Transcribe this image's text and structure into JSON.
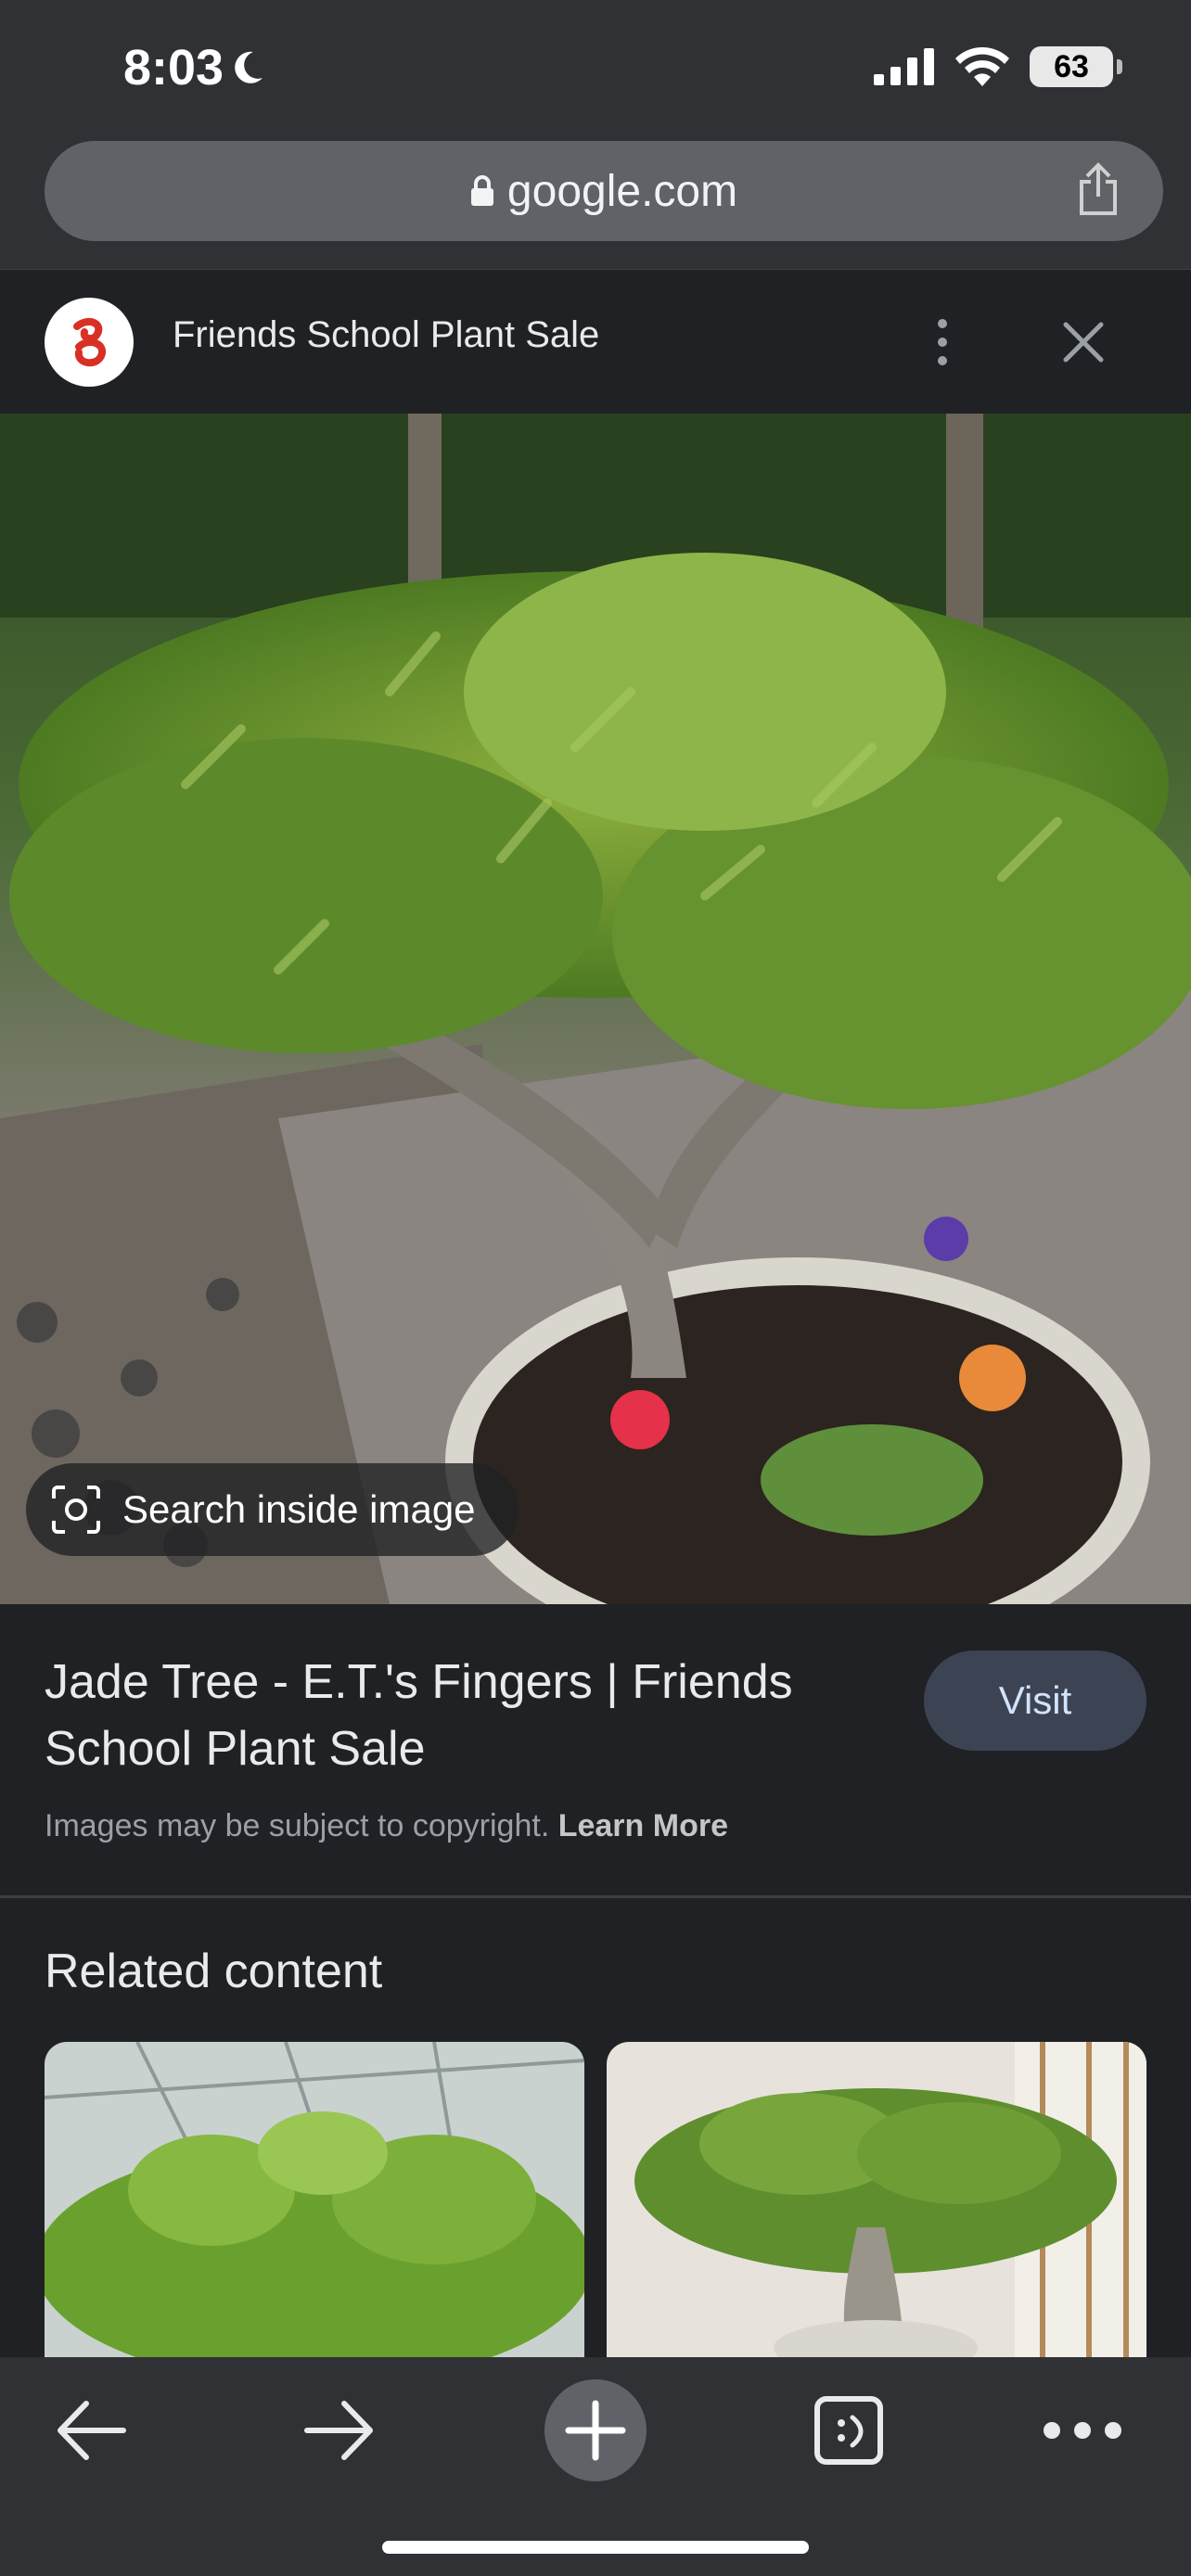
{
  "status_bar": {
    "time": "8:03",
    "battery": "63"
  },
  "browser": {
    "url": "google.com"
  },
  "source": {
    "title": "Friends School Plant Sale"
  },
  "image": {
    "search_inside_label": "Search inside image"
  },
  "result": {
    "title": "Jade Tree - E.T.'s Fingers | Friends School Plant Sale",
    "visit_label": "Visit",
    "copyright_text": "Images may be subject to copyright.",
    "learn_more_label": "Learn More"
  },
  "related": {
    "heading": "Related content"
  },
  "icons": {
    "moon": "moon-icon",
    "signal": "signal-icon",
    "wifi": "wifi-icon",
    "lock": "lock-icon",
    "share": "share-icon",
    "more": "more-vert-icon",
    "close": "close-icon",
    "lens": "lens-icon",
    "back": "back-arrow-icon",
    "forward": "forward-arrow-icon",
    "new_tab": "plus-icon",
    "tabs": "tabs-icon",
    "menu": "more-horiz-icon"
  },
  "colors": {
    "background": "#202124",
    "chrome": "#303134",
    "url_pill": "#5f6368",
    "visit_button": "#3c4453",
    "accent_logo": "#d93025"
  }
}
